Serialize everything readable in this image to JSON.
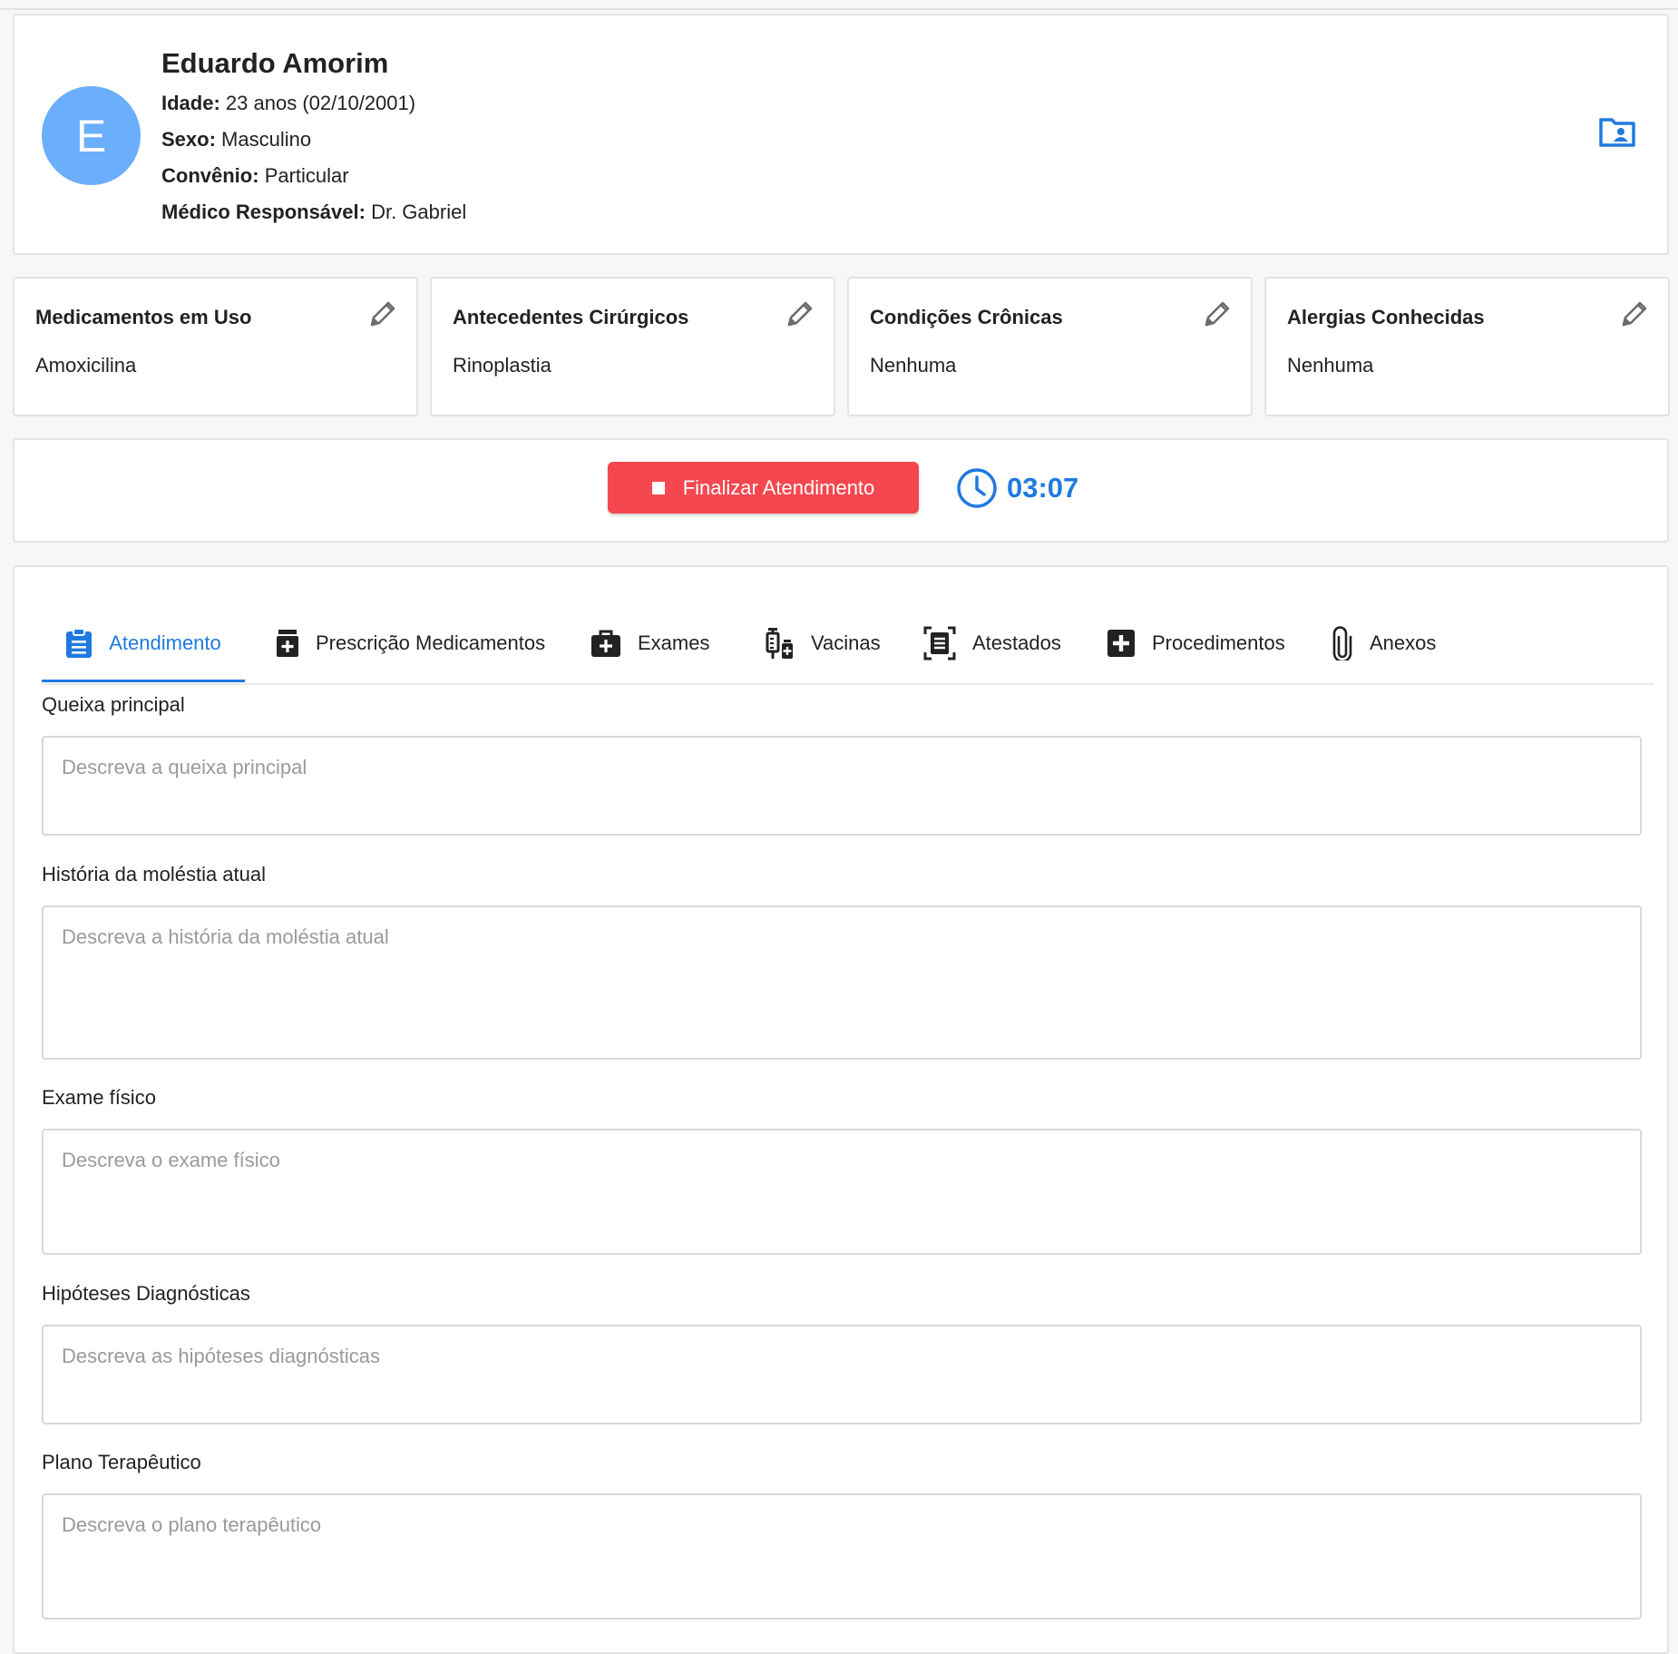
{
  "patient": {
    "avatar_letter": "E",
    "name": "Eduardo Amorim",
    "age_label": "Idade:",
    "age_value": "23 anos (02/10/2001)",
    "sex_label": "Sexo:",
    "sex_value": "Masculino",
    "insurance_label": "Convênio:",
    "insurance_value": "Particular",
    "doctor_label": "Médico Responsável:",
    "doctor_value": "Dr. Gabriel",
    "folder_icon": "folder-user-icon"
  },
  "info_cards": [
    {
      "title": "Medicamentos em Uso",
      "value": "Amoxicilina"
    },
    {
      "title": "Antecedentes Cirúrgicos",
      "value": "Rinoplastia"
    },
    {
      "title": "Condições Crônicas",
      "value": "Nenhuma"
    },
    {
      "title": "Alergias Conhecidas",
      "value": "Nenhuma"
    }
  ],
  "actions": {
    "finish_label": "Finalizar Atendimento",
    "timer": "03:07"
  },
  "tabs": [
    {
      "label": "Atendimento",
      "icon": "clipboard-icon",
      "active": true
    },
    {
      "label": "Prescrição Medicamentos",
      "icon": "medicine-bottle-icon"
    },
    {
      "label": "Exames",
      "icon": "medical-kit-icon"
    },
    {
      "label": "Vacinas",
      "icon": "vaccine-icon"
    },
    {
      "label": "Atestados",
      "icon": "document-scan-icon"
    },
    {
      "label": "Procedimentos",
      "icon": "plus-square-icon"
    },
    {
      "label": "Anexos",
      "icon": "paperclip-icon"
    }
  ],
  "form": {
    "fields": [
      {
        "label": "Queixa principal",
        "placeholder": "Descreva a queixa principal"
      },
      {
        "label": "História da moléstia atual",
        "placeholder": "Descreva a história da moléstia atual"
      },
      {
        "label": "Exame físico",
        "placeholder": "Descreva o exame físico"
      },
      {
        "label": "Hipóteses Diagnósticas",
        "placeholder": "Descreva as hipóteses diagnósticas"
      },
      {
        "label": "Plano Terapêutico",
        "placeholder": "Descreva o plano terapêutico"
      }
    ]
  },
  "colors": {
    "accent": "#1f7ae0",
    "danger": "#f5474f",
    "avatar": "#6aaefc"
  }
}
